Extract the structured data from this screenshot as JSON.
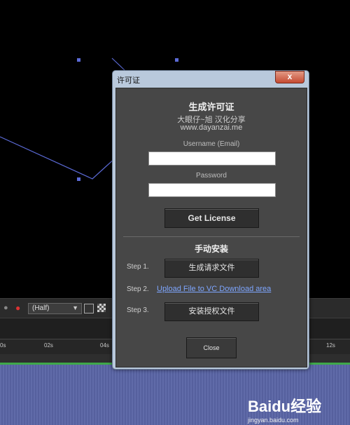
{
  "dialog": {
    "title": "许可证",
    "close_glyph": "x",
    "heading": "生成许可证",
    "credit": "大眼仔~旭 汉化分享",
    "website": "www.dayanzai.me",
    "username_label": "Username (Email)",
    "username_value": "",
    "password_label": "Password",
    "password_value": "",
    "get_license_label": "Get License",
    "manual_heading": "手动安装",
    "step1_label": "Step 1.",
    "step1_button": "生成请求文件",
    "step2_label": "Step 2.",
    "step2_link": "Upload File to VC Download area",
    "step3_label": "Step 3.",
    "step3_button": "安装授权文件",
    "close_label": "Close"
  },
  "background": {
    "resolution_dropdown": "(Half)",
    "ruler_ticks": [
      "0s",
      "02s",
      "04s",
      "12s"
    ]
  },
  "watermark": {
    "logo": "Baidu经验",
    "url": "jingyan.baidu.com"
  },
  "colors": {
    "viewer_bg": "#000000",
    "path_line": "#5b6ad6",
    "dialog_frame": "#b9c9dc",
    "client_bg": "#474747",
    "link": "#7ea6ff",
    "close_red": "#c54b32"
  }
}
